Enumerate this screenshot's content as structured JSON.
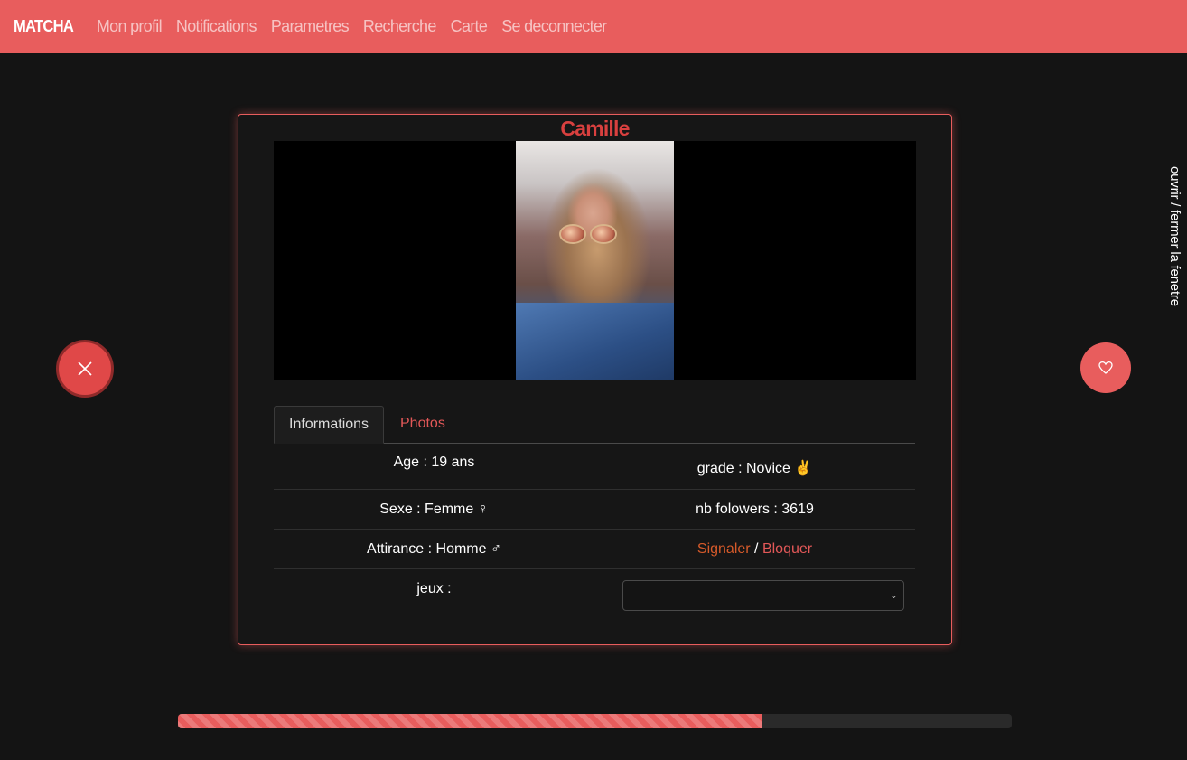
{
  "navbar": {
    "brand": "MATCHA",
    "links": [
      "Mon profil",
      "Notifications",
      "Parametres",
      "Recherche",
      "Carte",
      "Se deconnecter"
    ]
  },
  "profile": {
    "name": "Camille",
    "tabs": [
      "Informations",
      "Photos"
    ],
    "active_tab": "Informations",
    "info": {
      "age": "Age : 19 ans",
      "grade": "grade : Novice ✌️",
      "sexe": "Sexe : Femme ♀",
      "followers": "nb folowers : 3619",
      "attirance": "Attirance : Homme ♂",
      "report": "Signaler",
      "separator": "/",
      "block": "Bloquer",
      "games_label": "jeux :",
      "games_value": ""
    }
  },
  "actions": {
    "dislike_icon": "close-icon",
    "like_icon": "heart-icon"
  },
  "side_toggle": "ouvrir / fermer la fenetre",
  "progress": {
    "fraction": 0.7
  },
  "colors": {
    "accent": "#e85d5d",
    "name": "#d9403f",
    "link": "#e35858",
    "report_link": "#d65a2a",
    "background": "#141414"
  }
}
